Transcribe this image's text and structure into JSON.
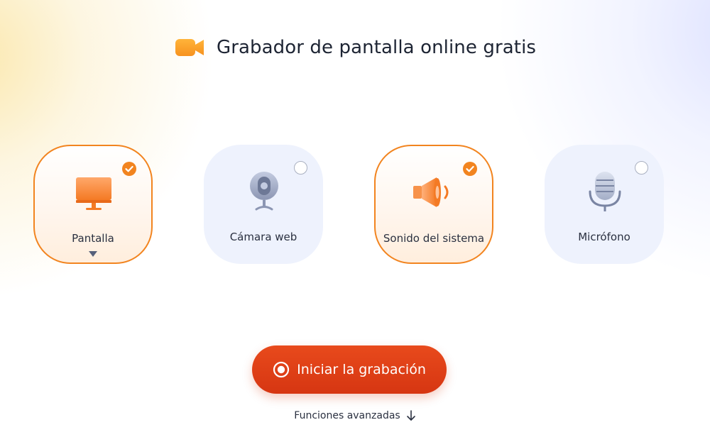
{
  "header": {
    "logo_icon": "video-camera-icon",
    "title": "Grabador de pantalla online gratis"
  },
  "options": [
    {
      "id": "pantalla",
      "label": "Pantalla",
      "icon": "monitor-icon",
      "selected": true,
      "has_dropdown": true
    },
    {
      "id": "camara",
      "label": "Cámara web",
      "icon": "webcam-icon",
      "selected": false,
      "has_dropdown": false
    },
    {
      "id": "sonido",
      "label": "Sonido del sistema",
      "icon": "speaker-icon",
      "selected": true,
      "has_dropdown": false
    },
    {
      "id": "microfono",
      "label": "Micrófono",
      "icon": "microphone-icon",
      "selected": false,
      "has_dropdown": false
    }
  ],
  "record_button": {
    "label": "Iniciar la grabación",
    "icon": "record-icon"
  },
  "advanced": {
    "label": "Funciones avanzadas",
    "icon": "arrow-down-icon"
  },
  "colors": {
    "accent_orange": "#f2841f",
    "record_red": "#d63612",
    "card_unselected_bg": "#eef2fd",
    "text_dark": "#1d2433"
  }
}
